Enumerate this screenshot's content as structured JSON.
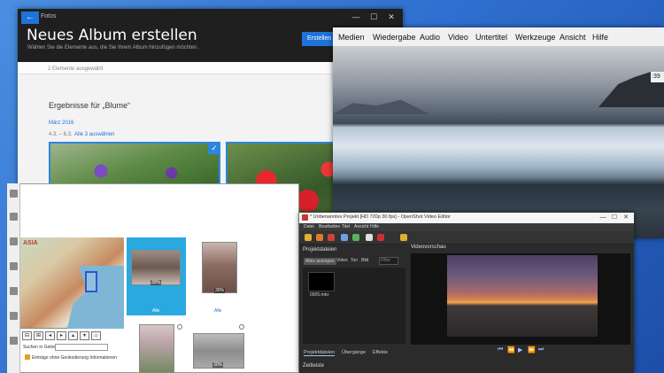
{
  "photos": {
    "app_title": "Fotos",
    "heading": "Neues Album erstellen",
    "subtitle": "Wählen Sie die Elemente aus, die Sie Ihrem Album hinzufügen möchten.",
    "create_button": "Erstellen",
    "selected_count": "2 Elemente ausgewählt",
    "results_heading": "Ergebnisse für „Blume“",
    "date_group": "März 2016",
    "range": "4.3. – 6.3.",
    "select_all": "Alle 3 auswählen",
    "check_mark": "✓",
    "back_glyph": "←",
    "window_controls": [
      "—",
      "☐",
      "✕"
    ]
  },
  "player": {
    "menu": [
      "Medien",
      "Wiedergabe",
      "Audio",
      "Video",
      "Untertitel",
      "Werkzeuge",
      "Ansicht",
      "Hilfe"
    ],
    "time": ":39"
  },
  "openshot": {
    "title": "* Unbenanntes Projekt [HD 720p 30 fps] - OpenShot Video Editor",
    "menu": [
      "Datei",
      "Bearbeiten",
      "Titel",
      "Ansicht",
      "Hilfe"
    ],
    "window_controls": [
      "—",
      "☐",
      "✕"
    ],
    "files_label": "Projektdateien",
    "preview_label": "Videovorschau",
    "filters": [
      "Alles anzeigen",
      "Video",
      "Ton",
      "Bild"
    ],
    "filter_search": "Filter",
    "file_name": "0005.mkv",
    "transport": [
      "⏮",
      "⏪",
      "▶",
      "⏩",
      "⏭"
    ],
    "tabs": [
      "Projektdateien",
      "Übergänge",
      "Effekte"
    ],
    "timeline_label": "Zeitleiste",
    "toolbar_colors": [
      "#e0b030",
      "#e07a2a",
      "#d04040",
      "#6fa0e0",
      "#5ab35a",
      "#e0e0e0",
      "#d03030"
    ]
  },
  "gallery": {
    "map_label": "ASIA",
    "map_buttons": [
      "⊟",
      "⊞",
      "◂",
      "▸",
      "▴",
      "▾",
      "⌂"
    ],
    "search_label": "Suchen in Gebiet:",
    "note": "Einträge ohne Geokodierung Informationen",
    "captions": [
      "Alle",
      "Alle"
    ],
    "badges": [
      "30%",
      "30%",
      "30%"
    ]
  }
}
